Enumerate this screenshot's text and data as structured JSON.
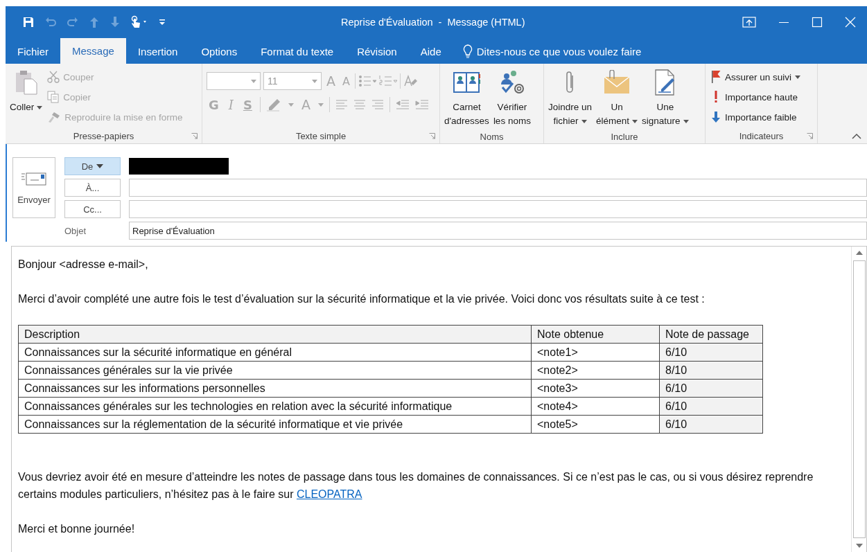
{
  "window": {
    "title": "Reprise d'Évaluation  -  Message (HTML)"
  },
  "tabs": [
    {
      "label": "Fichier",
      "selected": false
    },
    {
      "label": "Message",
      "selected": true
    },
    {
      "label": "Insertion",
      "selected": false
    },
    {
      "label": "Options",
      "selected": false
    },
    {
      "label": "Format du texte",
      "selected": false
    },
    {
      "label": "Révision",
      "selected": false
    },
    {
      "label": "Aide",
      "selected": false
    }
  ],
  "tell_me": {
    "placeholder": "Dites-nous ce que vous voulez faire"
  },
  "ribbon_groups": [
    {
      "label": "Presse-papiers",
      "kind": "buttons",
      "launcher": true,
      "items": [
        {
          "kind": "large",
          "lines": [
            "Coller"
          ],
          "dropdown": true,
          "disabled": false
        },
        {
          "kind": "small",
          "lines": [
            "Couper"
          ],
          "dropdown": false,
          "disabled": true
        },
        {
          "kind": "small",
          "lines": [
            "Copier"
          ],
          "dropdown": false,
          "disabled": true
        },
        {
          "kind": "small",
          "lines": [
            "Reproduire la mise en forme"
          ],
          "dropdown": false,
          "disabled": true
        }
      ]
    },
    {
      "label": "Texte simple",
      "kind": "format",
      "launcher": true,
      "format": {
        "size": "11",
        "grow_shrink": [
          "A",
          "A"
        ],
        "styles": [
          "G",
          "I",
          "S"
        ],
        "font_color": "A",
        "disabled": true
      }
    },
    {
      "label": "Noms",
      "kind": "buttons",
      "launcher": false,
      "items": [
        {
          "kind": "large",
          "lines": [
            "Carnet",
            "d'adresses"
          ],
          "dropdown": false,
          "disabled": false
        },
        {
          "kind": "large",
          "lines": [
            "Vérifier",
            "les noms"
          ],
          "dropdown": false,
          "disabled": false
        }
      ]
    },
    {
      "label": "Inclure",
      "kind": "buttons",
      "launcher": false,
      "items": [
        {
          "kind": "large",
          "lines": [
            "Joindre un",
            "fichier"
          ],
          "dropdown": true,
          "disabled": false
        },
        {
          "kind": "large",
          "lines": [
            "Un",
            "élément"
          ],
          "dropdown": true,
          "disabled": false
        },
        {
          "kind": "large",
          "lines": [
            "Une",
            "signature"
          ],
          "dropdown": true,
          "disabled": false
        }
      ]
    },
    {
      "label": "Indicateurs",
      "kind": "buttons",
      "launcher": true,
      "items": [
        {
          "kind": "small",
          "lines": [
            "Assurer un suivi"
          ],
          "dropdown": true,
          "disabled": false
        },
        {
          "kind": "small",
          "lines": [
            "Importance haute"
          ],
          "dropdown": false,
          "disabled": false
        },
        {
          "kind": "small",
          "lines": [
            "Importance faible"
          ],
          "dropdown": false,
          "disabled": false
        }
      ]
    }
  ],
  "header": {
    "send_button": "Envoyer",
    "fields": [
      {
        "kind": "from",
        "label": "De",
        "selected": true,
        "redacted": true
      },
      {
        "kind": "address",
        "label": "À...",
        "selected": false
      },
      {
        "kind": "address",
        "label": "Cc...",
        "selected": false
      },
      {
        "kind": "subject",
        "label": "Objet",
        "value": "Reprise d'Évaluation"
      }
    ]
  },
  "body": {
    "greeting": "Bonjour <adresse e-mail>,",
    "intro": "Merci d’avoir complété une autre fois le test d’évaluation sur la sécurité informatique et la vie privée. Voici donc vos résultats suite à ce test :",
    "table": {
      "columns": [
        "Description",
        "Note obtenue",
        "Note de passage"
      ],
      "rows": [
        [
          "Connaissances sur la sécurité informatique en général",
          "<note1>",
          "6/10"
        ],
        [
          "Connaissances générales sur la vie privée",
          "<note2>",
          "8/10"
        ],
        [
          "Connaissances sur les informations personnelles",
          "<note3>",
          "6/10"
        ],
        [
          "Connaissances générales sur les technologies en relation avec la sécurité informatique",
          "<note4>",
          "6/10"
        ],
        [
          "Connaissances sur la réglementation de la sécurité informatique et vie privée",
          "<note5>",
          "6/10"
        ]
      ]
    },
    "closing": {
      "text": "Vous devriez avoir été en mesure d’atteindre les notes de passage dans tous les domaines de connaissances. Si ce n’est pas le cas, ou si vous désirez reprendre certains modules particuliers, n’hésitez pas à le faire sur ",
      "link": "CLEOPATRA"
    },
    "signoff": "Merci et bonne journée!"
  }
}
